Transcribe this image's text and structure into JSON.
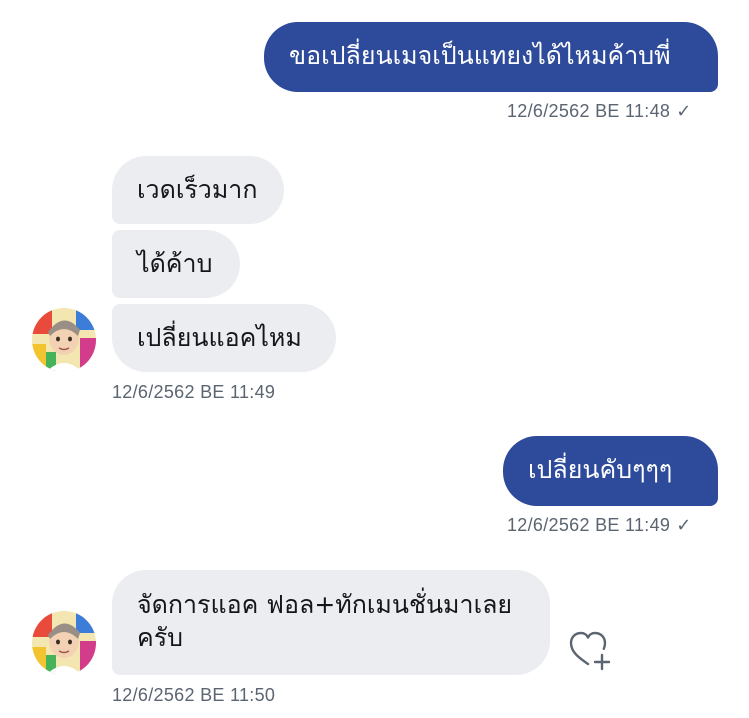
{
  "messages": [
    {
      "dir": "out",
      "text": "ขอเปลี่ยนเมจเป็นแทยงได้ไหมค้าบพี่"
    },
    {
      "dir": "in",
      "text": "เวดเร็วมาก"
    },
    {
      "dir": "in",
      "text": "ได้ค้าบ"
    },
    {
      "dir": "in",
      "text": "เปลี่ยนแอคไหม"
    },
    {
      "dir": "out",
      "text": "เปลี่ยนคับๆๆๆ"
    },
    {
      "dir": "in",
      "text_line1": "จัดการแอค ฟอล+ทักเมนชั่นมาเลย",
      "text_line2": "ครับ"
    }
  ],
  "timestamps": {
    "t1": "12/6/2562 BE 11:48",
    "t2": "12/6/2562 BE 11:49",
    "t3": "12/6/2562 BE 11:49",
    "t4": "12/6/2562 BE 11:50"
  },
  "read_check": "✓",
  "icons": {
    "avatar": "avatar-image",
    "like": "heart-plus-icon"
  },
  "colors": {
    "outgoing_bubble": "#2e4a9a",
    "incoming_bubble": "#ebedf0",
    "timestamp": "#5b6571"
  }
}
